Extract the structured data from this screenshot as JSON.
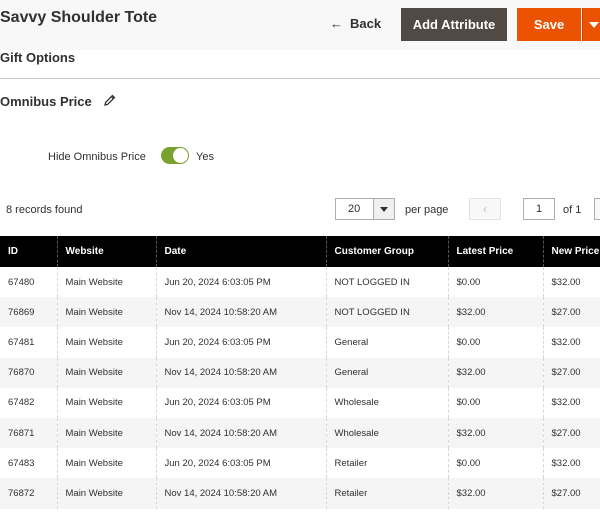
{
  "header": {
    "title": "Savvy Shoulder Tote",
    "back_label": "Back",
    "back_arrow": "←",
    "add_attribute_label": "Add Attribute",
    "save_label": "Save"
  },
  "sections": {
    "gift_options": "Gift Options",
    "omnibus_price": "Omnibus Price"
  },
  "toggle": {
    "label": "Hide Omnibus Price",
    "value_label": "Yes",
    "on": true,
    "color": "#79a22e"
  },
  "grid_toolbar": {
    "records_found": "8 records found",
    "per_page_value": "20",
    "per_page_label": "per page",
    "prev_symbol": "‹",
    "current_page": "1",
    "of_label": "of 1"
  },
  "table": {
    "columns": [
      "ID",
      "Website",
      "Date",
      "Customer Group",
      "Latest Price",
      "New Price"
    ],
    "rows": [
      [
        "67480",
        "Main Website",
        "Jun 20, 2024 6:03:05 PM",
        "NOT LOGGED IN",
        "$0.00",
        "$32.00"
      ],
      [
        "76869",
        "Main Website",
        "Nov 14, 2024 10:58:20 AM",
        "NOT LOGGED IN",
        "$32.00",
        "$27.00"
      ],
      [
        "67481",
        "Main Website",
        "Jun 20, 2024 6:03:05 PM",
        "General",
        "$0.00",
        "$32.00"
      ],
      [
        "76870",
        "Main Website",
        "Nov 14, 2024 10:58:20 AM",
        "General",
        "$32.00",
        "$27.00"
      ],
      [
        "67482",
        "Main Website",
        "Jun 20, 2024 6:03:05 PM",
        "Wholesale",
        "$0.00",
        "$32.00"
      ],
      [
        "76871",
        "Main Website",
        "Nov 14, 2024 10:58:20 AM",
        "Wholesale",
        "$32.00",
        "$27.00"
      ],
      [
        "67483",
        "Main Website",
        "Jun 20, 2024 6:03:05 PM",
        "Retailer",
        "$0.00",
        "$32.00"
      ],
      [
        "76872",
        "Main Website",
        "Nov 14, 2024 10:58:20 AM",
        "Retailer",
        "$32.00",
        "$27.00"
      ]
    ]
  },
  "colors": {
    "save": "#eb5202",
    "add_attribute": "#514943",
    "table_header": "#000000"
  }
}
